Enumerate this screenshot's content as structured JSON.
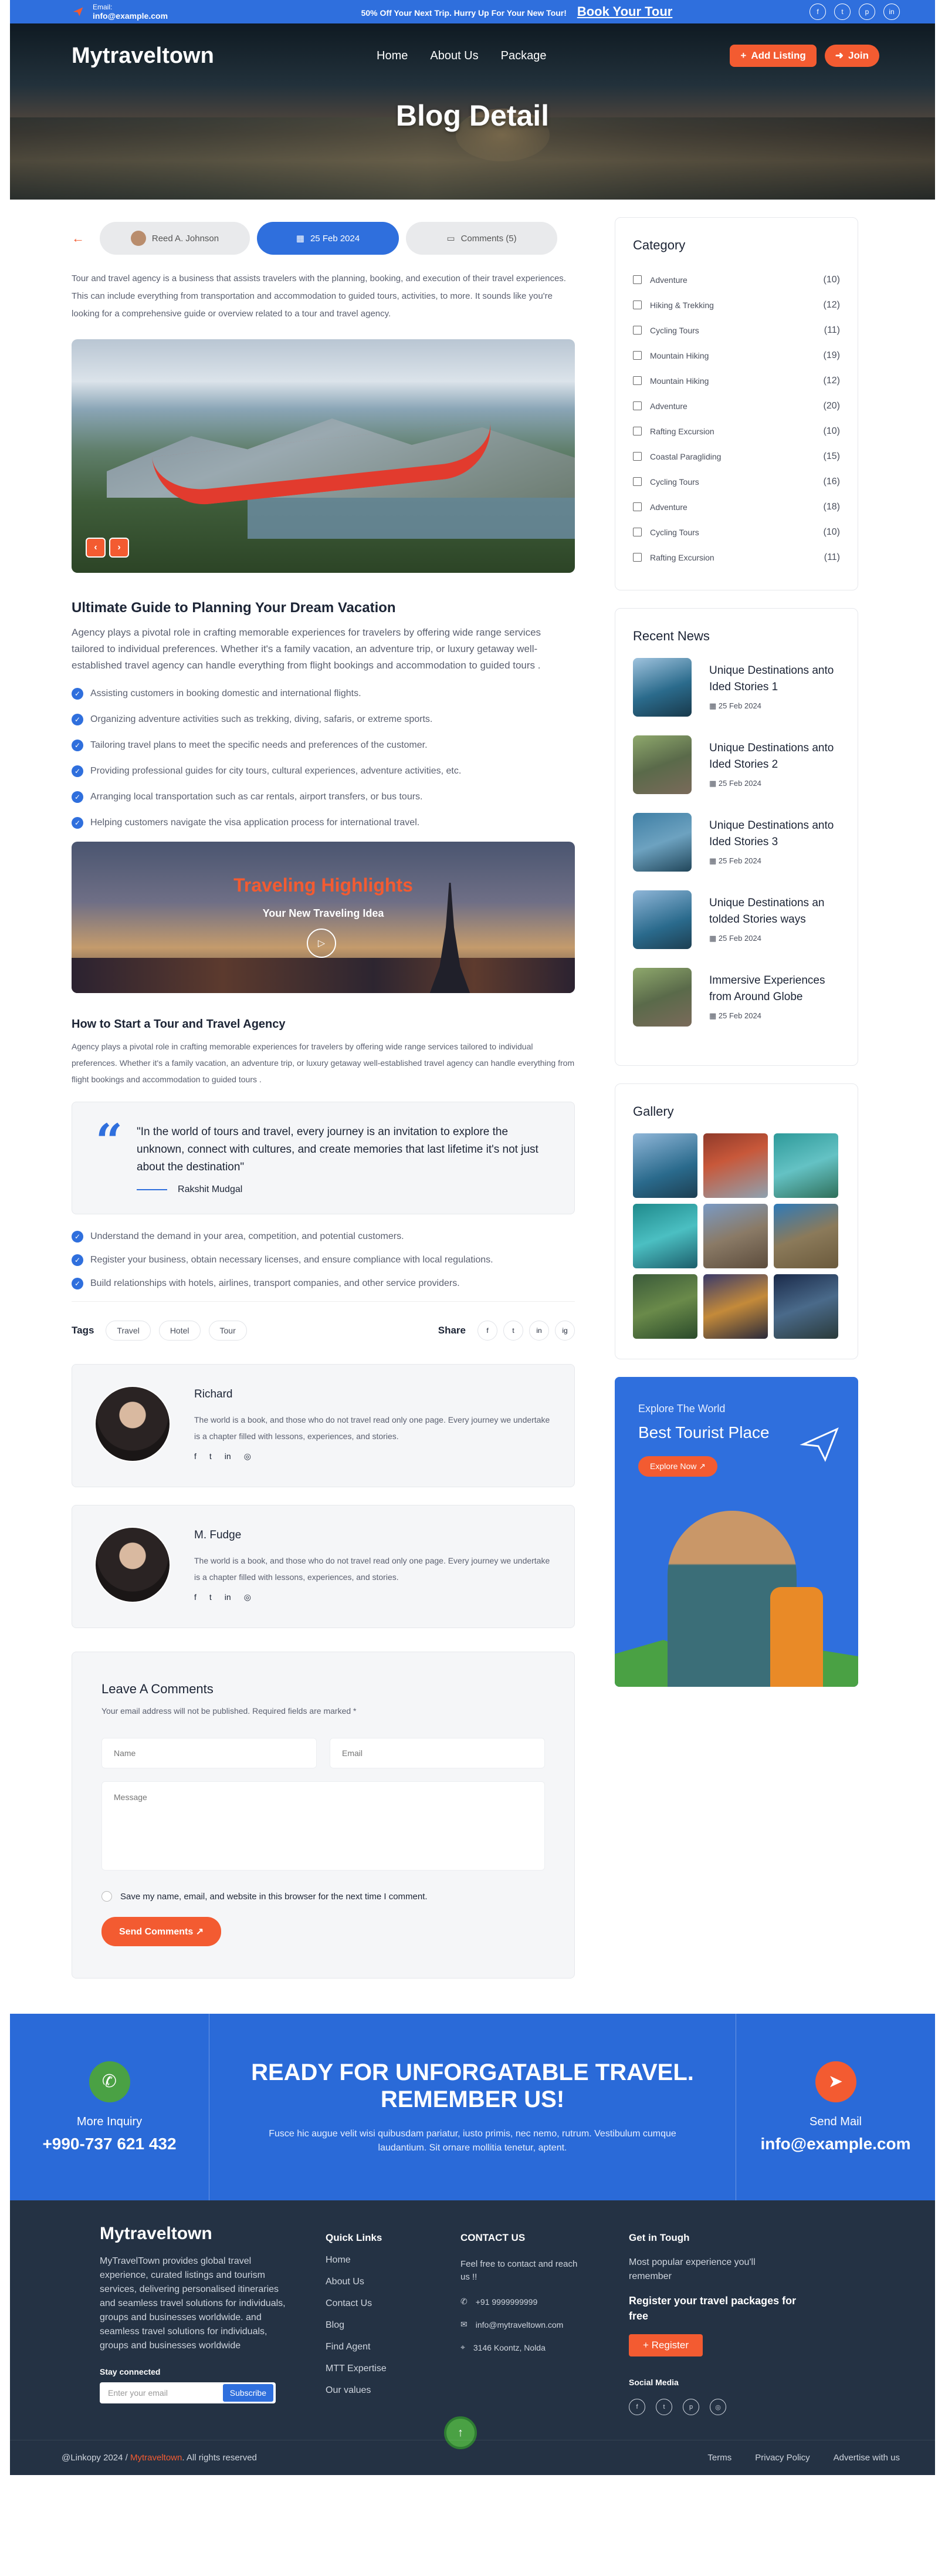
{
  "topbar": {
    "email_label": "Email:",
    "email": "info@example.com",
    "promo": "50% Off Your Next Trip. Hurry Up For Your New Tour!",
    "promo_link": "Book Your Tour",
    "socials": [
      "f",
      "t",
      "p",
      "in"
    ]
  },
  "nav": {
    "logo": "Mytraveltown",
    "menu": [
      "Home",
      "About Us",
      "Package"
    ],
    "add_listing": "Add Listing",
    "join": "Join"
  },
  "hero": {
    "title": "Blog Detail"
  },
  "post": {
    "author": "Reed A. Johnson",
    "date": "25 Feb 2024",
    "comments": "Comments (5)",
    "intro": "Tour and travel agency is a business that assists travelers with the planning, booking, and execution of their travel experiences. This can include everything from transportation and accommodation to guided tours, activities, to more. It sounds like you're looking for a comprehensive guide or overview related to a tour and travel agency.",
    "heading1": "Ultimate Guide to Planning Your Dream Vacation",
    "para1": "Agency plays a pivotal role in crafting memorable experiences for travelers by offering wide range services tailored to individual preferences. Whether it's a family vacation, an adventure trip, or luxury getaway well-established travel agency can handle everything from flight bookings and accommodation to guided tours .",
    "checklist1": [
      "Assisting customers in booking domestic and international flights.",
      "Organizing adventure activities such as trekking, diving, safaris, or extreme sports.",
      "Tailoring travel plans to meet the specific needs and preferences of the customer.",
      "Providing professional guides for city tours, cultural experiences, adventure activities, etc.",
      "Arranging local transportation such as car rentals, airport transfers, or bus tours.",
      "Helping customers navigate the visa application process for international travel."
    ],
    "video_title": "Traveling Highlights",
    "video_sub": "Your New Traveling Idea",
    "heading2": "How to Start a Tour and Travel Agency",
    "para2": "Agency plays a pivotal role in crafting memorable experiences for travelers by offering wide range services tailored to individual preferences. Whether it's a family vacation, an adventure trip, or luxury getaway well-established travel agency can handle everything from flight bookings and accommodation to guided tours .",
    "quote": "\"In the world of tours and travel, every journey is an invitation to explore the unknown, connect with cultures, and create memories that last lifetime it's not just about the destination\"",
    "quote_author": "Rakshit Mudgal",
    "checklist2": [
      "Understand the demand in your area, competition, and potential customers.",
      "Register your business, obtain necessary licenses, and ensure compliance with local regulations.",
      "Build relationships with hotels, airlines, transport companies, and other service providers."
    ],
    "tags_label": "Tags",
    "tags": [
      "Travel",
      "Hotel",
      "Tour"
    ],
    "share_label": "Share",
    "share_icons": [
      "f",
      "t",
      "in",
      "ig"
    ]
  },
  "authors": [
    {
      "name": "Richard",
      "text": "The world is a book, and those who do not travel read only one page. Every journey we undertake is a chapter filled with lessons, experiences, and stories."
    },
    {
      "name": "M. Fudge",
      "text": "The world is a book, and those who do not travel read only one page. Every journey we undertake is a chapter filled with lessons, experiences, and stories."
    }
  ],
  "comment_form": {
    "title": "Leave A Comments",
    "note": "Your email address will not be published. Required fields are marked *",
    "name_ph": "Name",
    "email_ph": "Email",
    "message_ph": "Message",
    "save": "Save my name, email, and website in this browser for the next time I comment.",
    "send": "Send Comments"
  },
  "sidebar": {
    "category_title": "Category",
    "categories": [
      {
        "name": "Adventure",
        "count": "(10)"
      },
      {
        "name": "Hiking & Trekking",
        "count": "(12)"
      },
      {
        "name": "Cycling Tours",
        "count": "(11)"
      },
      {
        "name": "Mountain Hiking",
        "count": "(19)"
      },
      {
        "name": "Mountain Hiking",
        "count": "(12)"
      },
      {
        "name": "Adventure",
        "count": "(20)"
      },
      {
        "name": "Rafting Excursion",
        "count": "(10)"
      },
      {
        "name": "Coastal Paragliding",
        "count": "(15)"
      },
      {
        "name": "Cycling Tours",
        "count": "(16)"
      },
      {
        "name": "Adventure",
        "count": "(18)"
      },
      {
        "name": "Cycling Tours",
        "count": "(10)"
      },
      {
        "name": "Rafting Excursion",
        "count": "(11)"
      }
    ],
    "news_title": "Recent News",
    "news": [
      {
        "title": "Unique Destinations anto Ided Stories 1",
        "date": "25 Feb 2024"
      },
      {
        "title": "Unique Destinations anto Ided Stories 2",
        "date": "25 Feb 2024"
      },
      {
        "title": "Unique Destinations anto Ided Stories 3",
        "date": "25 Feb 2024"
      },
      {
        "title": "Unique Destinations an tolded Stories ways",
        "date": "25 Feb 2024"
      },
      {
        "title": "Immersive Experiences from Around Globe",
        "date": "25 Feb 2024"
      }
    ],
    "gallery_title": "Gallery",
    "ad_kicker": "Explore The World",
    "ad_title": "Best Tourist Place",
    "ad_button": "Explore Now"
  },
  "cta": {
    "inquiry_label": "More Inquiry",
    "phone": "+990-737 621 432",
    "title": "READY FOR UNFORGATABLE TRAVEL. REMEMBER US!",
    "text": "Fusce hic augue velit wisi quibusdam pariatur, iusto primis, nec nemo, rutrum. Vestibulum cumque laudantium. Sit ornare mollitia tenetur, aptent.",
    "mail_label": "Send Mail",
    "mail": "info@example.com"
  },
  "footer": {
    "logo": "Mytraveltown",
    "about": "MyTravelTown provides global travel experience, curated listings and tourism services, delivering personalised itineraries and seamless travel solutions for individuals, groups and businesses worldwide.  and seamless travel solutions for individuals, groups and businesses worldwide",
    "stay": "Stay connected",
    "sub_ph": "Enter your email",
    "sub_btn": "Subscribe",
    "quick_title": "Quick Links",
    "quick_links": [
      "Home",
      "About Us",
      "Contact Us",
      "Blog",
      "Find Agent",
      "MTT Expertise",
      "Our values"
    ],
    "contact_title": "CONTACT US",
    "contact_text": "Feel free to contact and reach us !!",
    "contact_phone": "+91 9999999999",
    "contact_email": "info@mytraveltown.com",
    "contact_addr": "3146 Koontz, Nolda",
    "touch_title": "Get in Tough",
    "touch_text": "Most popular experience you'll remember",
    "touch_reg": "Register your travel packages for free",
    "register": "Register",
    "social_title": "Social Media",
    "copyright_pre": "@Linkopy 2024 /",
    "copyright_brand": "Mytraveltown",
    "copyright_post": ". All rights reserved",
    "bottom_links": [
      "Terms",
      "Privacy Policy",
      "Advertise with us"
    ]
  }
}
